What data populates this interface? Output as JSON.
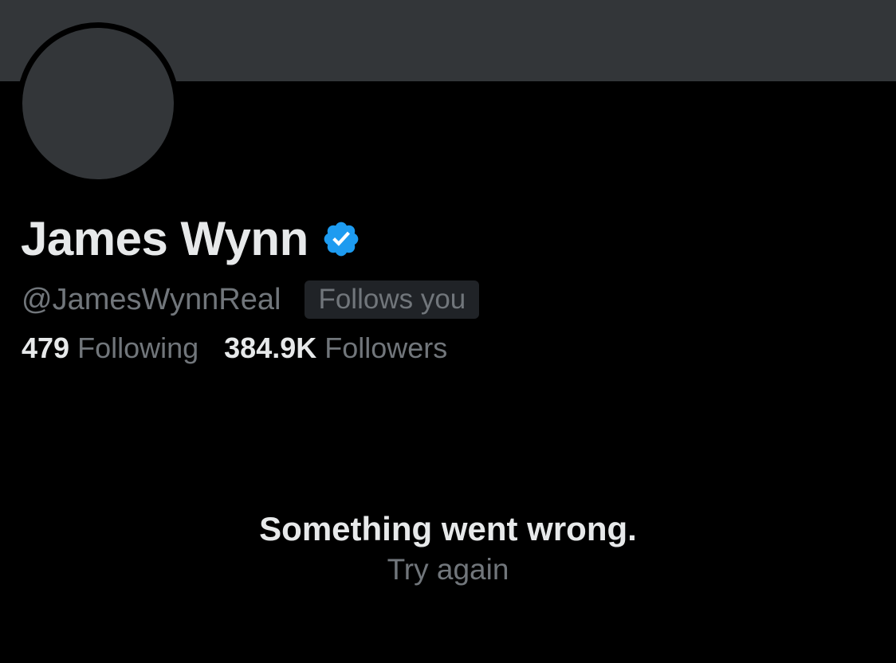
{
  "profile": {
    "display_name": "James Wynn",
    "handle": "@JamesWynnReal",
    "follows_you_badge": "Follows you",
    "verified_icon": "verified-badge-icon",
    "verified_color": "#1d9bf0"
  },
  "stats": {
    "following_count": "479",
    "following_label": "Following",
    "followers_count": "384.9K",
    "followers_label": "Followers"
  },
  "error": {
    "message": "Something went wrong.",
    "retry_label": "Try again"
  },
  "colors": {
    "background": "#000000",
    "banner": "#333639",
    "avatar_placeholder": "#333639",
    "primary_text": "#e7e9ea",
    "secondary_text": "#71767b",
    "badge_background": "#202327"
  }
}
